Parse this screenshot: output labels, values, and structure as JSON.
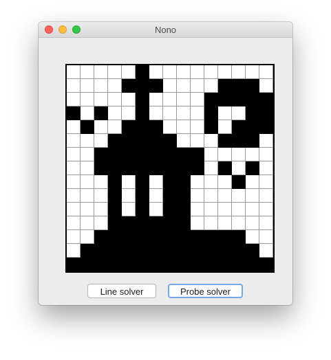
{
  "window": {
    "title": "Nono"
  },
  "puzzle": {
    "rows": 15,
    "cols": 15,
    "filled_color": "#000000",
    "empty_color": "#ffffff",
    "cells": [
      "00000100000000",
      "000011100001110",
      "000001000011111",
      "101001000010011",
      "010011100010111",
      "000111110001110",
      "001111111100000",
      "001111111101010",
      "000101011000100",
      "000101011000000",
      "000101011000000",
      "000111111000000",
      "001111111111100",
      "011111111111110",
      "111111111111111"
    ]
  },
  "buttons": {
    "line_solver": "Line solver",
    "probe_solver": "Probe solver"
  }
}
